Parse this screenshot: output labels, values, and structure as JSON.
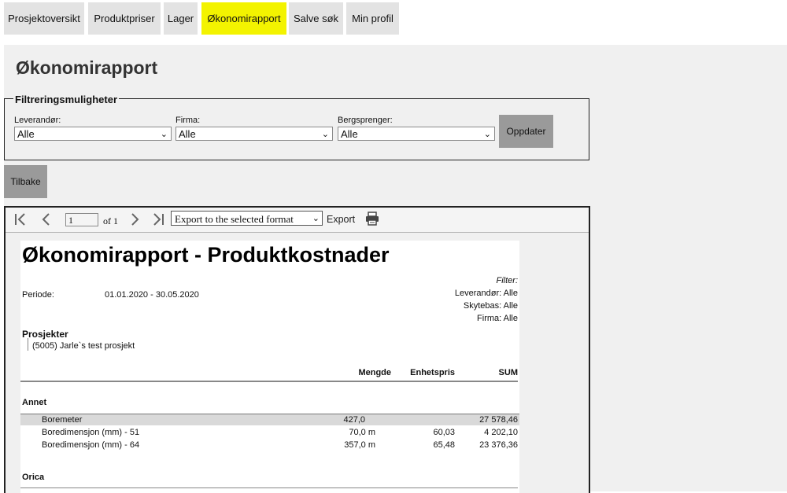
{
  "nav": {
    "tabs": [
      {
        "label": "Prosjektoversikt"
      },
      {
        "label": "Produktpriser"
      },
      {
        "label": "Lager"
      },
      {
        "label": "Økonomirapport"
      },
      {
        "label": "Salve søk"
      },
      {
        "label": "Min profil"
      }
    ],
    "active_color": "#f3f300"
  },
  "page": {
    "title": "Økonomirapport"
  },
  "filters": {
    "legend": "Filtreringsmuligheter",
    "fields": [
      {
        "label": "Leverandør:",
        "value": "Alle"
      },
      {
        "label": "Firma:",
        "value": "Alle"
      },
      {
        "label": "Bergsprenger:",
        "value": "Alle"
      }
    ],
    "update_label": "Oppdater"
  },
  "back_label": "Tilbake",
  "viewer": {
    "page_value": "1",
    "of_text": "of 1",
    "export_format": "Export to the selected format",
    "export_label": "Export",
    "icons": [
      "first-page-icon",
      "prev-page-icon",
      "next-page-icon",
      "last-page-icon",
      "print-icon"
    ]
  },
  "report": {
    "title": "Økonomirapport - Produktkostnader",
    "period_label": "Periode:",
    "period_value": "01.01.2020 - 30.05.2020",
    "filter_heading": "Filter:",
    "filter_lines": [
      "Leverandør: Alle",
      "Skytebas: Alle",
      "Firma: Alle"
    ],
    "projects_heading": "Prosjekter",
    "project_item": "(5005) Jarle`s test prosjekt",
    "columns": {
      "qty": "Mengde",
      "unit_price": "Enhetspris",
      "sum": "SUM"
    },
    "groups": [
      {
        "name": "Annet",
        "rows": [
          {
            "name": "Boremeter",
            "qty": "427,0",
            "unit_price": "",
            "sum": "27 578,46"
          },
          {
            "name": "Boredimensjon (mm) - 51",
            "qty": "70,0 m",
            "unit_price": "60,03",
            "sum": "4 202,10"
          },
          {
            "name": "Boredimensjon (mm) - 64",
            "qty": "357,0 m",
            "unit_price": "65,48",
            "sum": "23 376,36"
          }
        ]
      },
      {
        "name": "Orica",
        "rows": []
      }
    ]
  }
}
